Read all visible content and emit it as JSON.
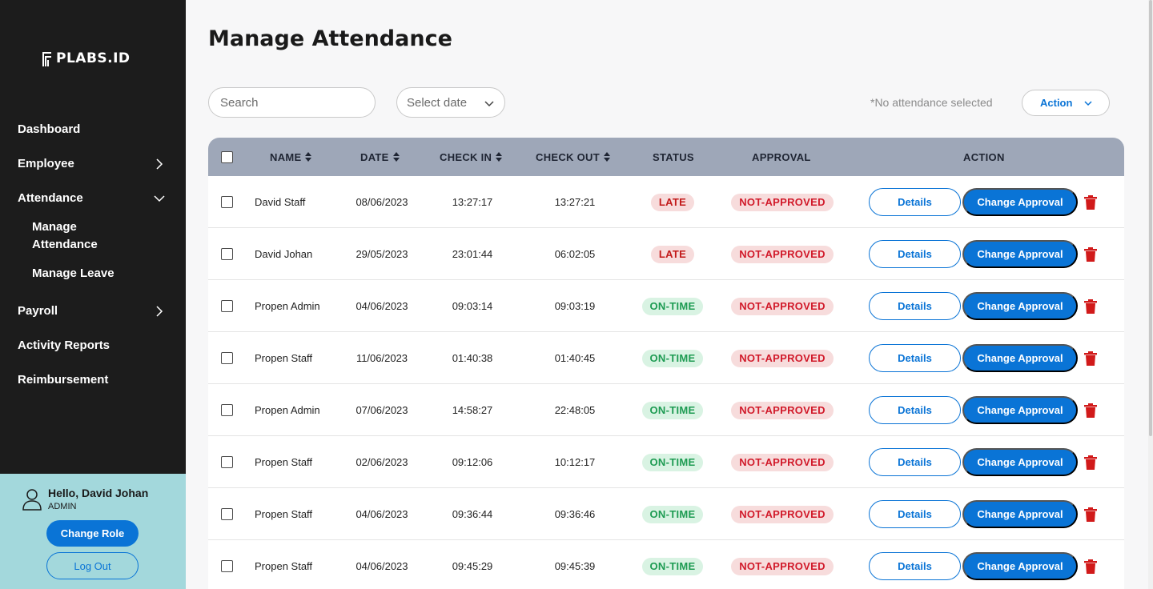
{
  "brand": {
    "name": "PLABS.ID"
  },
  "sidebar": {
    "items": [
      {
        "label": "Dashboard"
      },
      {
        "label": "Employee"
      },
      {
        "label": "Attendance"
      },
      {
        "label": "Payroll"
      },
      {
        "label": "Activity Reports"
      },
      {
        "label": "Reimbursement"
      }
    ],
    "attendance_sub": [
      {
        "label": "Manage Attendance"
      },
      {
        "label": "Manage Leave"
      }
    ]
  },
  "user": {
    "greeting": "Hello, David Johan",
    "role": "ADMIN",
    "change_role_label": "Change Role",
    "logout_label": "Log Out"
  },
  "main": {
    "title": "Manage Attendance",
    "search_placeholder": "Search",
    "date_placeholder": "Select date",
    "selection_status": "*No attendance selected",
    "action_label": "Action"
  },
  "table": {
    "headers": {
      "name": "NAME",
      "date": "DATE",
      "check_in": "CHECK IN",
      "check_out": "CHECK OUT",
      "status": "STATUS",
      "approval": "APPROVAL",
      "action": "ACTION"
    },
    "details_label": "Details",
    "change_label": "Change Approval",
    "rows": [
      {
        "name": "David Staff",
        "date": "08/06/2023",
        "check_in": "13:27:17",
        "check_out": "13:27:21",
        "status": "LATE",
        "approval": "NOT-APPROVED"
      },
      {
        "name": "David Johan",
        "date": "29/05/2023",
        "check_in": "23:01:44",
        "check_out": "06:02:05",
        "status": "LATE",
        "approval": "NOT-APPROVED"
      },
      {
        "name": "Propen Admin",
        "date": "04/06/2023",
        "check_in": "09:03:14",
        "check_out": "09:03:19",
        "status": "ON-TIME",
        "approval": "NOT-APPROVED"
      },
      {
        "name": "Propen Staff",
        "date": "11/06/2023",
        "check_in": "01:40:38",
        "check_out": "01:40:45",
        "status": "ON-TIME",
        "approval": "NOT-APPROVED"
      },
      {
        "name": "Propen Admin",
        "date": "07/06/2023",
        "check_in": "14:58:27",
        "check_out": "22:48:05",
        "status": "ON-TIME",
        "approval": "NOT-APPROVED"
      },
      {
        "name": "Propen Staff",
        "date": "02/06/2023",
        "check_in": "09:12:06",
        "check_out": "10:12:17",
        "status": "ON-TIME",
        "approval": "NOT-APPROVED"
      },
      {
        "name": "Propen Staff",
        "date": "04/06/2023",
        "check_in": "09:36:44",
        "check_out": "09:36:46",
        "status": "ON-TIME",
        "approval": "NOT-APPROVED"
      },
      {
        "name": "Propen Staff",
        "date": "04/06/2023",
        "check_in": "09:45:29",
        "check_out": "09:45:39",
        "status": "ON-TIME",
        "approval": "NOT-APPROVED"
      }
    ]
  },
  "colors": {
    "accent": "#0a74d6",
    "sidebar_bg": "#1c1c1c",
    "user_panel_bg": "#a3d8dc",
    "header_bg": "#9ea7b8",
    "late_red": "#c21a1a",
    "ontime_green": "#1d9b52"
  },
  "icons": [
    "logo-mark-icon",
    "chevron-right-icon",
    "chevron-down-icon",
    "user-icon",
    "sort-icon",
    "trash-icon"
  ]
}
